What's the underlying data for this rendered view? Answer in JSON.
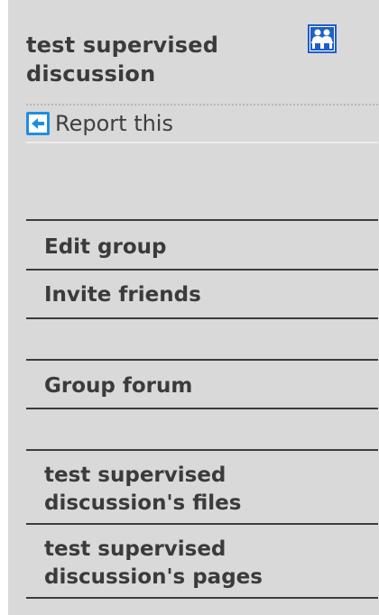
{
  "group": {
    "title": "test supervised discussion",
    "icon": "group-members-icon"
  },
  "report": {
    "label": "Report this",
    "icon": "report-arrow-icon"
  },
  "menu": {
    "edit_group": "Edit group",
    "invite_friends": "Invite friends",
    "group_forum": "Group forum",
    "files": "test supervised discussion's files",
    "pages": "test supervised discussion's pages"
  },
  "colors": {
    "panel_background": "#d9d9d9",
    "text": "#3b3b3b",
    "icon_blue": "#1f5fc8"
  }
}
